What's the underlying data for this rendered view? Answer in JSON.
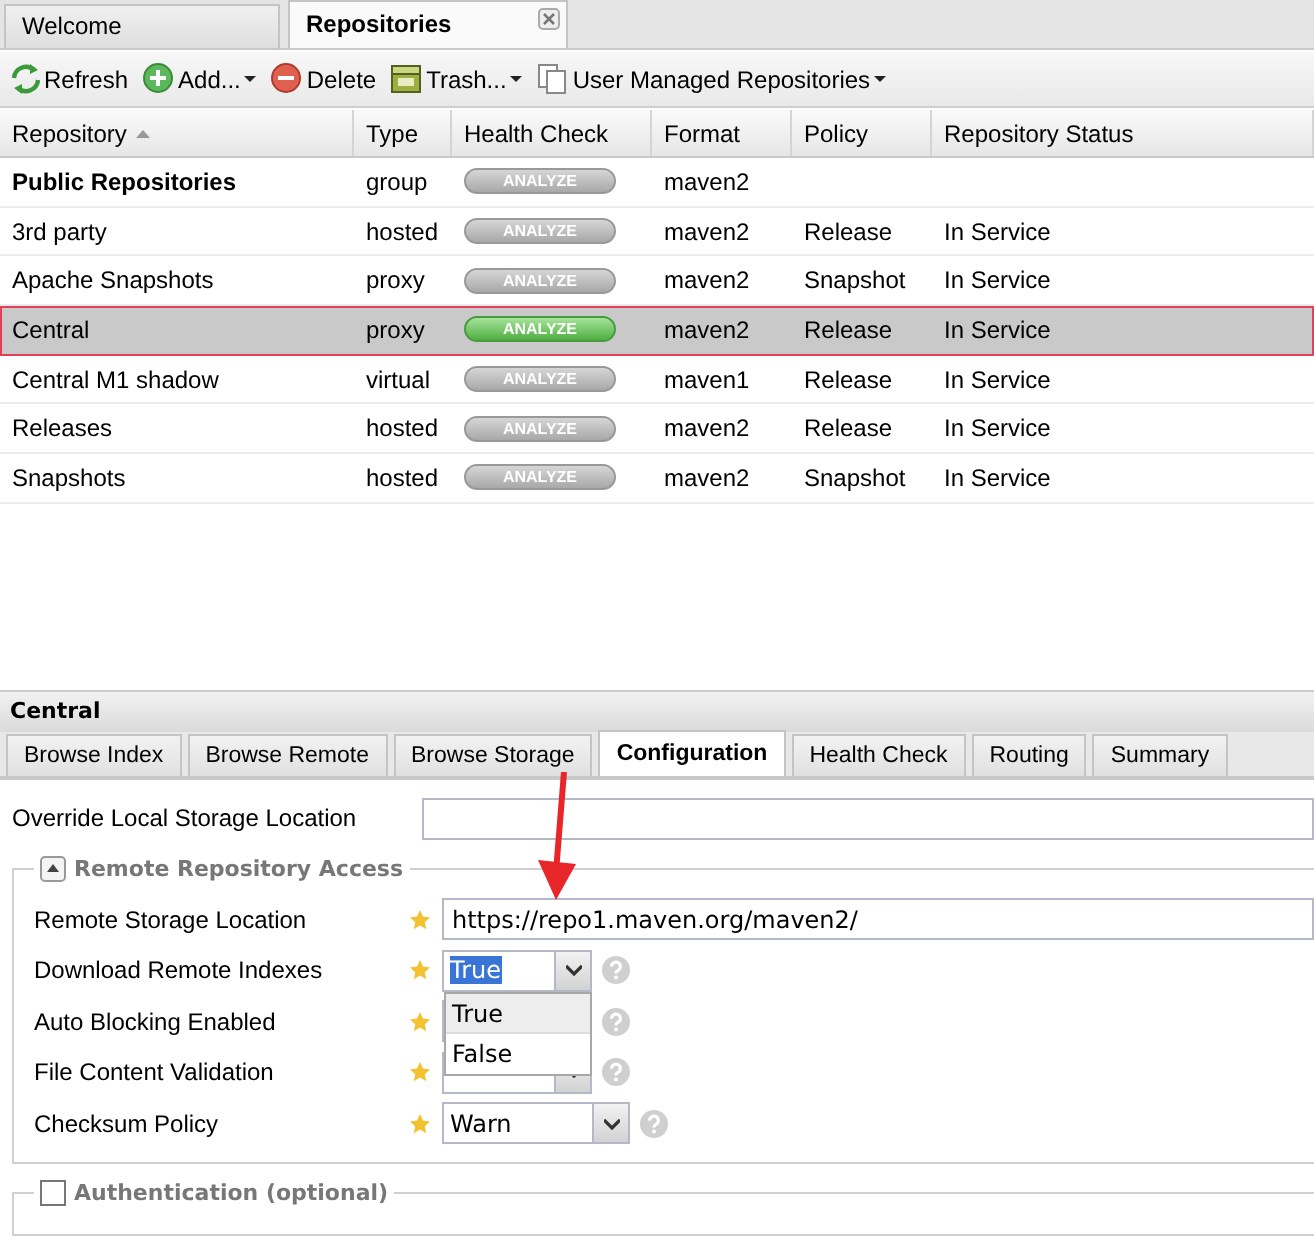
{
  "main_tabs": [
    {
      "label": "Welcome",
      "selected": false,
      "closable": false
    },
    {
      "label": "Repositories",
      "selected": true,
      "closable": true
    }
  ],
  "toolbar": [
    {
      "kind": "refresh",
      "label": "Refresh",
      "menu": false
    },
    {
      "kind": "add",
      "label": "Add...",
      "menu": true
    },
    {
      "kind": "delete",
      "label": "Delete",
      "menu": false
    },
    {
      "kind": "trash",
      "label": "Trash...",
      "menu": true
    },
    {
      "kind": "docs",
      "label": "User Managed Repositories",
      "menu": true
    }
  ],
  "table": {
    "columns": [
      {
        "label": "Repository",
        "sorted": true
      },
      {
        "label": "Type",
        "sorted": false
      },
      {
        "label": "Health Check",
        "sorted": false
      },
      {
        "label": "Format",
        "sorted": false
      },
      {
        "label": "Policy",
        "sorted": false
      },
      {
        "label": "Repository Status",
        "sorted": false
      }
    ],
    "rows": [
      {
        "name": "Public Repositories",
        "group": true,
        "type": "group",
        "analyze": "ANALYZE",
        "analyze_active": false,
        "format": "maven2",
        "policy": "",
        "status": "",
        "selected": false
      },
      {
        "name": "3rd party",
        "group": false,
        "type": "hosted",
        "analyze": "ANALYZE",
        "analyze_active": false,
        "format": "maven2",
        "policy": "Release",
        "status": "In Service",
        "selected": false
      },
      {
        "name": "Apache Snapshots",
        "group": false,
        "type": "proxy",
        "analyze": "ANALYZE",
        "analyze_active": false,
        "format": "maven2",
        "policy": "Snapshot",
        "status": "In Service",
        "selected": false
      },
      {
        "name": "Central",
        "group": false,
        "type": "proxy",
        "analyze": "ANALYZE",
        "analyze_active": true,
        "format": "maven2",
        "policy": "Release",
        "status": "In Service",
        "selected": true
      },
      {
        "name": "Central M1 shadow",
        "group": false,
        "type": "virtual",
        "analyze": "ANALYZE",
        "analyze_active": false,
        "format": "maven1",
        "policy": "Release",
        "status": "In Service",
        "selected": false
      },
      {
        "name": "Releases",
        "group": false,
        "type": "hosted",
        "analyze": "ANALYZE",
        "analyze_active": false,
        "format": "maven2",
        "policy": "Release",
        "status": "In Service",
        "selected": false
      },
      {
        "name": "Snapshots",
        "group": false,
        "type": "hosted",
        "analyze": "ANALYZE",
        "analyze_active": false,
        "format": "maven2",
        "policy": "Snapshot",
        "status": "In Service",
        "selected": false
      }
    ]
  },
  "detail": {
    "title": "Central",
    "tabs": [
      {
        "label": "Browse Index",
        "selected": false
      },
      {
        "label": "Browse Remote",
        "selected": false
      },
      {
        "label": "Browse Storage",
        "selected": false
      },
      {
        "label": "Configuration",
        "selected": true
      },
      {
        "label": "Health Check",
        "selected": false
      },
      {
        "label": "Routing",
        "selected": false
      },
      {
        "label": "Summary",
        "selected": false
      }
    ],
    "override_label": "Override Local Storage Location",
    "remote_access": {
      "legend": "Remote Repository Access",
      "expanded": true,
      "fields": [
        {
          "kind": "text",
          "label": "Remote Storage Location",
          "value": "https://repo1.maven.org/maven2/"
        },
        {
          "kind": "combo",
          "label": "Download Remote Indexes",
          "value": "True",
          "focused": true,
          "options": [
            {
              "label": "True",
              "selected": true
            },
            {
              "label": "False",
              "selected": false
            }
          ]
        },
        {
          "kind": "combo",
          "label": "Auto Blocking Enabled"
        },
        {
          "kind": "combo",
          "label": "File Content Validation"
        },
        {
          "kind": "combo",
          "label": "Checksum Policy",
          "value": "Warn"
        }
      ]
    },
    "authentication": {
      "legend": "Authentication (optional)",
      "checked": false
    }
  }
}
